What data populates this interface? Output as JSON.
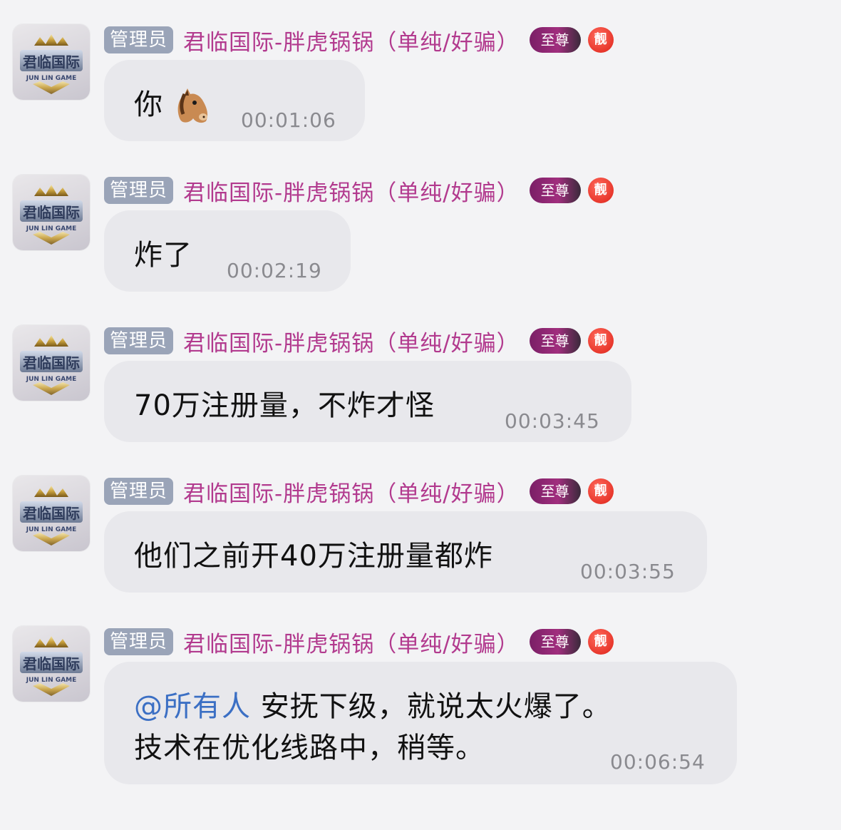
{
  "sender": {
    "role": "管理员",
    "name": "君临国际-胖虎锅锅（单纯/好骗）",
    "vip_badge": "至尊",
    "special_badge": "靓",
    "avatar_text": "君临国际",
    "avatar_subtext": "JUN LIN GAME"
  },
  "colors": {
    "sender_name": "#b23a8e",
    "role_badge": "#9aa4b8",
    "bubble": "#e8e8ec",
    "mention": "#3b6fc4"
  },
  "messages": [
    {
      "text": "你",
      "emoji": "horse-face",
      "time": "00:01:06"
    },
    {
      "text": "炸了",
      "time": "00:02:19"
    },
    {
      "text": "70万注册量，不炸才怪",
      "time": "00:03:45"
    },
    {
      "text": "他们之前开40万注册量都炸",
      "time": "00:03:55"
    },
    {
      "mention": "@所有人",
      "text": " 安抚下级，就说太火爆了。",
      "text_line2": "技术在优化线路中，稍等。",
      "time": "00:06:54"
    }
  ]
}
